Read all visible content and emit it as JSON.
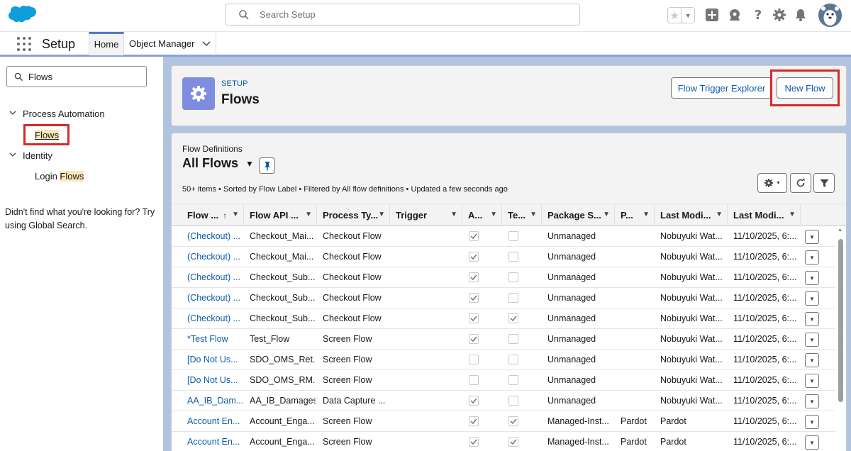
{
  "global_search": {
    "placeholder": "Search Setup"
  },
  "nav": {
    "app_name": "Setup",
    "tabs": {
      "home": "Home",
      "object_manager": "Object Manager"
    }
  },
  "sidebar": {
    "quick_find_value": "Flows",
    "sections": [
      {
        "label": "Process Automation",
        "items": [
          {
            "label": "Flows"
          }
        ]
      },
      {
        "label": "Identity",
        "items": [
          {
            "label_prefix": "Login ",
            "label_highlight": "Flows"
          }
        ]
      }
    ],
    "help_text": "Didn't find what you're looking for? Try using Global Search."
  },
  "page_header": {
    "eyebrow": "SETUP",
    "title": "Flows",
    "buttons": {
      "flow_trigger_explorer": "Flow Trigger Explorer",
      "new_flow": "New Flow"
    }
  },
  "list_view": {
    "eyebrow": "Flow Definitions",
    "title": "All Flows",
    "meta": "50+ items • Sorted by Flow Label • Filtered by All flow definitions • Updated a few seconds ago",
    "columns": [
      "Flow ...",
      "Flow API ...",
      "Process Ty...",
      "Trigger",
      "A...",
      "Te...",
      "Package S...",
      "P...",
      "Last Modi...",
      "Last Modi..."
    ],
    "rows": [
      {
        "label": "(Checkout) ...",
        "api": "Checkout_Mai...",
        "type": "Checkout Flow",
        "trigger": "",
        "active": true,
        "template": false,
        "package": "Unmanaged",
        "p": "",
        "modified_by": "Nobuyuki Wat...",
        "modified_date": "11/10/2025, 6:..."
      },
      {
        "label": "(Checkout) ...",
        "api": "Checkout_Mai...",
        "type": "Checkout Flow",
        "trigger": "",
        "active": true,
        "template": false,
        "package": "Unmanaged",
        "p": "",
        "modified_by": "Nobuyuki Wat...",
        "modified_date": "11/10/2025, 6:..."
      },
      {
        "label": "(Checkout) ...",
        "api": "Checkout_Sub...",
        "type": "Checkout Flow",
        "trigger": "",
        "active": true,
        "template": false,
        "package": "Unmanaged",
        "p": "",
        "modified_by": "Nobuyuki Wat...",
        "modified_date": "11/10/2025, 6:..."
      },
      {
        "label": "(Checkout) ...",
        "api": "Checkout_Sub...",
        "type": "Checkout Flow",
        "trigger": "",
        "active": true,
        "template": false,
        "package": "Unmanaged",
        "p": "",
        "modified_by": "Nobuyuki Wat...",
        "modified_date": "11/10/2025, 6:..."
      },
      {
        "label": "(Checkout) ...",
        "api": "Checkout_Sub...",
        "type": "Checkout Flow",
        "trigger": "",
        "active": true,
        "template": true,
        "package": "Unmanaged",
        "p": "",
        "modified_by": "Nobuyuki Wat...",
        "modified_date": "11/10/2025, 6:..."
      },
      {
        "label": "*Test Flow",
        "api": "Test_Flow",
        "type": "Screen Flow",
        "trigger": "",
        "active": true,
        "template": false,
        "package": "Unmanaged",
        "p": "",
        "modified_by": "Nobuyuki Wat...",
        "modified_date": "11/10/2025, 6:..."
      },
      {
        "label": "[Do Not Us...",
        "api": "SDO_OMS_Ret...",
        "type": "Screen Flow",
        "trigger": "",
        "active": false,
        "template": false,
        "package": "Unmanaged",
        "p": "",
        "modified_by": "Nobuyuki Wat...",
        "modified_date": "11/10/2025, 6:..."
      },
      {
        "label": "[Do Not Us...",
        "api": "SDO_OMS_RM...",
        "type": "Screen Flow",
        "trigger": "",
        "active": false,
        "template": false,
        "package": "Unmanaged",
        "p": "",
        "modified_by": "Nobuyuki Wat...",
        "modified_date": "11/10/2025, 6:..."
      },
      {
        "label": "AA_IB_Dam...",
        "api": "AA_IB_Damages",
        "type": "Data Capture ...",
        "trigger": "",
        "active": true,
        "template": false,
        "package": "Unmanaged",
        "p": "",
        "modified_by": "Nobuyuki Wat...",
        "modified_date": "11/10/2025, 6:..."
      },
      {
        "label": "Account En...",
        "api": "Account_Enga...",
        "type": "Screen Flow",
        "trigger": "",
        "active": true,
        "template": true,
        "package": "Managed-Inst...",
        "p": "Pardot",
        "modified_by": "Pardot",
        "modified_date": "11/10/2025, 6:..."
      },
      {
        "label": "Account En...",
        "api": "Account_Enga...",
        "type": "Screen Flow",
        "trigger": "",
        "active": true,
        "template": true,
        "package": "Managed-Inst...",
        "p": "Pardot",
        "modified_by": "Pardot",
        "modified_date": "11/10/2025, 6:..."
      }
    ]
  }
}
